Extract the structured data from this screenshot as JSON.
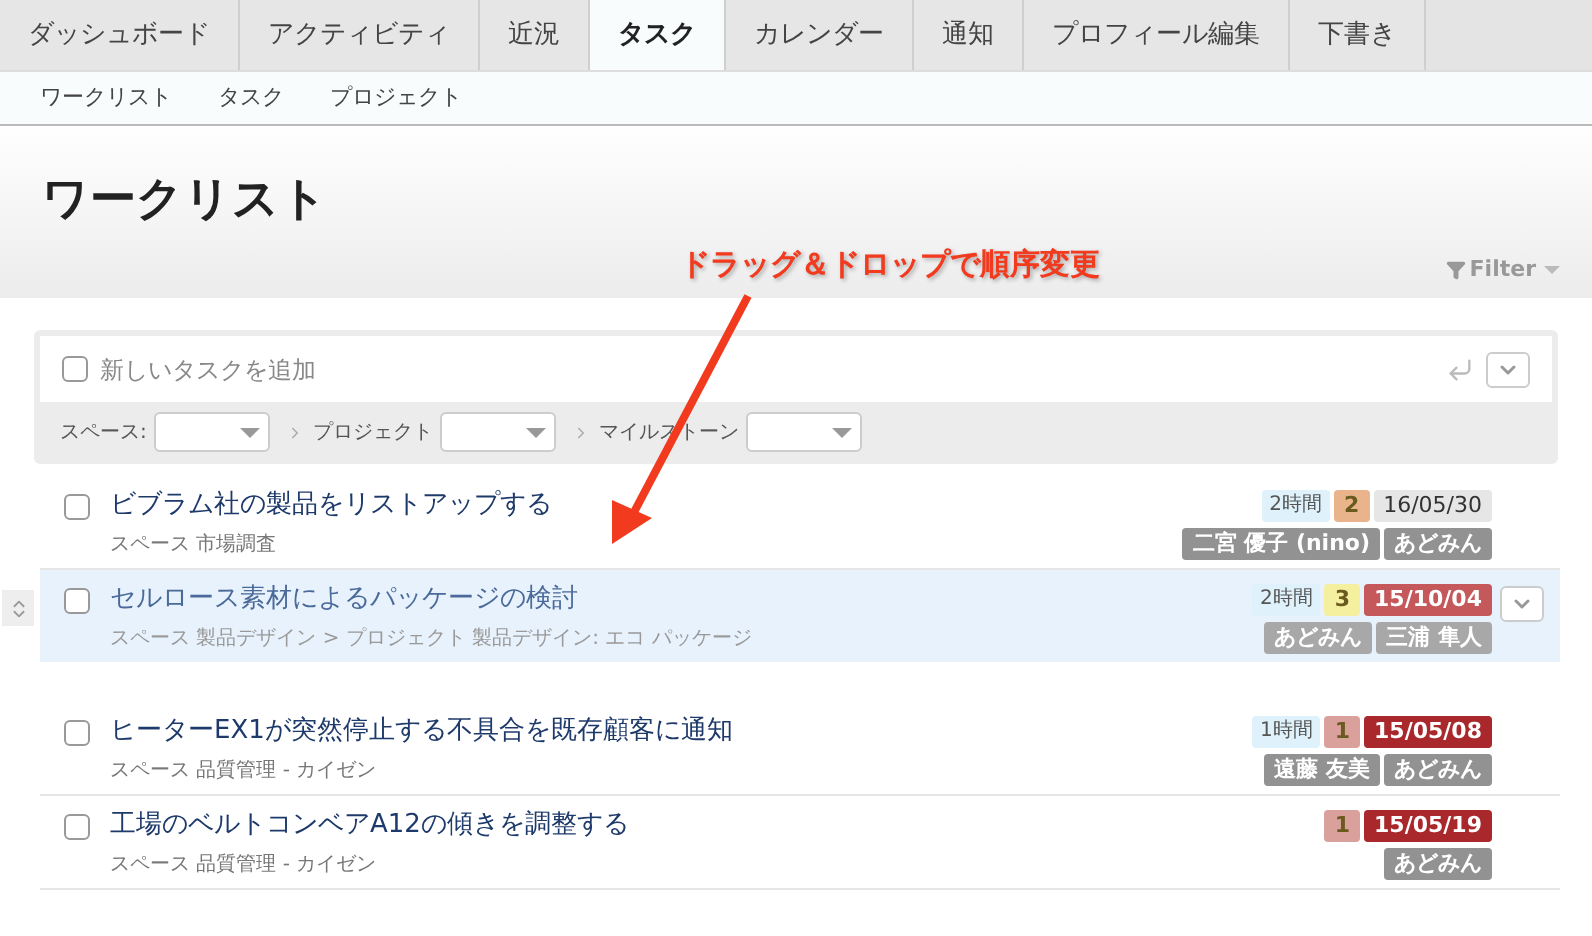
{
  "tabs": [
    {
      "label": "ダッシュボード",
      "selected": false
    },
    {
      "label": "アクティビティ",
      "selected": false
    },
    {
      "label": "近況",
      "selected": false
    },
    {
      "label": "タスク",
      "selected": true
    },
    {
      "label": "カレンダー",
      "selected": false
    },
    {
      "label": "通知",
      "selected": false
    },
    {
      "label": "プロフィール編集",
      "selected": false
    },
    {
      "label": "下書き",
      "selected": false
    }
  ],
  "subnav": [
    "ワークリスト",
    "タスク",
    "プロジェクト"
  ],
  "page_title": "ワークリスト",
  "annotation": "ドラッグ＆ドロップで順序変更",
  "filter_button": "Filter",
  "new_task": {
    "checked": false,
    "placeholder": "新しいタスクを追加",
    "filters": [
      "スペース:",
      "プロジェクト",
      "マイルストーン"
    ]
  },
  "tasks": [
    {
      "title": "ビブラム社の製品をリストアップする",
      "meta": "スペース 市場調査",
      "checked": false,
      "dragging": false,
      "estimate": "2時間",
      "priority": {
        "label": "2",
        "color": "#e9b48c"
      },
      "due": {
        "label": "16/05/30",
        "overdue": false
      },
      "assignees": [
        "二宮 優子 (nino)",
        "あどみん"
      ]
    },
    {
      "title": "セルロース素材によるパッケージの検討",
      "meta": "スペース 製品デザイン > プロジェクト 製品デザイン: エコ パッケージ",
      "checked": false,
      "dragging": true,
      "estimate": "2時間",
      "priority": {
        "label": "3",
        "color": "#f5efa0"
      },
      "due": {
        "label": "15/10/04",
        "overdue": true
      },
      "assignees": [
        "あどみん",
        "三浦 隼人"
      ]
    },
    {
      "title": "ヒーターEX1が突然停止する不具合を既存顧客に通知",
      "meta": "スペース 品質管理 - カイゼン",
      "checked": false,
      "dragging": false,
      "estimate": "1時間",
      "priority": {
        "label": "1",
        "color": "#d9a09c"
      },
      "due": {
        "label": "15/05/08",
        "overdue": true
      },
      "assignees": [
        "遠藤 友美",
        "あどみん"
      ]
    },
    {
      "title": "工場のベルトコンベアA12の傾きを調整する",
      "meta": "スペース 品質管理 - カイゼン",
      "checked": false,
      "dragging": false,
      "priority": {
        "label": "1",
        "color": "#d9a09c"
      },
      "due": {
        "label": "15/05/19",
        "overdue": true
      },
      "assignees": [
        "あどみん"
      ]
    }
  ]
}
